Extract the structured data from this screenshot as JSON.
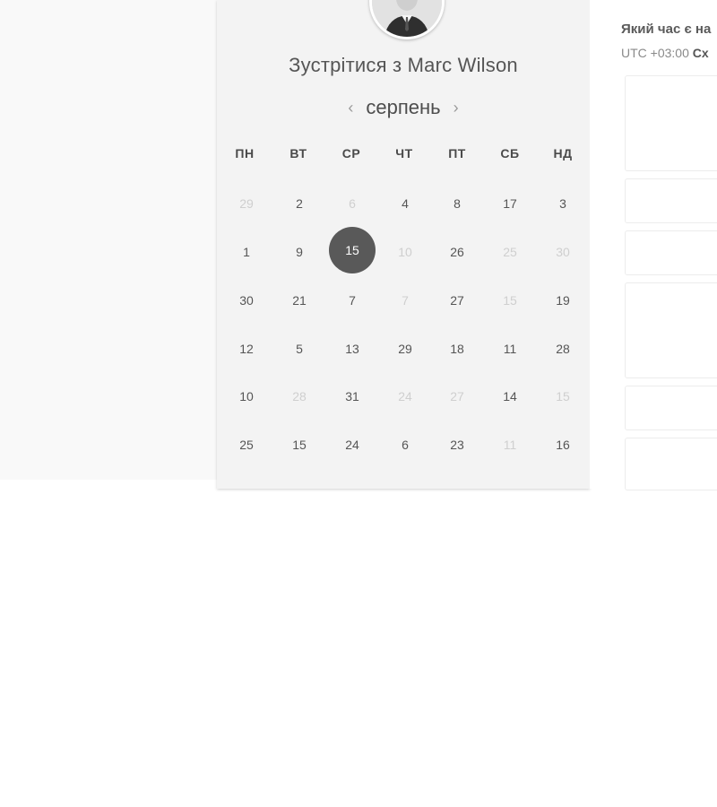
{
  "calendar": {
    "title_prefix": "Зустрітися з",
    "host_name": "Marc Wilson",
    "month": "серпень",
    "prev_arrow": "‹",
    "next_arrow": "›",
    "weekdays": [
      "ПН",
      "ВТ",
      "СР",
      "ЧТ",
      "ПТ",
      "СБ",
      "НД"
    ],
    "selected_day": "15",
    "rows": [
      [
        {
          "d": "29",
          "on": false
        },
        {
          "d": "2",
          "on": true
        },
        {
          "d": "6",
          "on": false
        },
        {
          "d": "4",
          "on": true
        },
        {
          "d": "8",
          "on": true
        },
        {
          "d": "17",
          "on": true
        },
        {
          "d": "3",
          "on": true
        }
      ],
      [
        {
          "d": "1",
          "on": true
        },
        {
          "d": "9",
          "on": true
        },
        {
          "d": "15",
          "on": true,
          "selected": true
        },
        {
          "d": "10",
          "on": false
        },
        {
          "d": "26",
          "on": true
        },
        {
          "d": "25",
          "on": false
        },
        {
          "d": "30",
          "on": false
        }
      ],
      [
        {
          "d": "30",
          "on": true
        },
        {
          "d": "21",
          "on": true
        },
        {
          "d": "7",
          "on": true
        },
        {
          "d": "7",
          "on": false
        },
        {
          "d": "27",
          "on": true
        },
        {
          "d": "15",
          "on": false
        },
        {
          "d": "19",
          "on": true
        }
      ],
      [
        {
          "d": "12",
          "on": true
        },
        {
          "d": "5",
          "on": true
        },
        {
          "d": "13",
          "on": true
        },
        {
          "d": "29",
          "on": true
        },
        {
          "d": "18",
          "on": true
        },
        {
          "d": "11",
          "on": true
        },
        {
          "d": "28",
          "on": true
        }
      ],
      [
        {
          "d": "10",
          "on": true
        },
        {
          "d": "28",
          "on": false
        },
        {
          "d": "31",
          "on": true
        },
        {
          "d": "24",
          "on": false
        },
        {
          "d": "27",
          "on": false
        },
        {
          "d": "14",
          "on": true
        },
        {
          "d": "15",
          "on": false
        }
      ],
      [
        {
          "d": "25",
          "on": true
        },
        {
          "d": "15",
          "on": true
        },
        {
          "d": "24",
          "on": true
        },
        {
          "d": "6",
          "on": true
        },
        {
          "d": "23",
          "on": true
        },
        {
          "d": "11",
          "on": false
        },
        {
          "d": "16",
          "on": true
        }
      ]
    ]
  },
  "time_panel": {
    "question": "Який час є на",
    "utc_offset": "UTC +03:00",
    "timezone_name": "Сх"
  },
  "colors": {
    "selected_day_bg": "#595959",
    "card_bg": "#f3f3f3"
  }
}
